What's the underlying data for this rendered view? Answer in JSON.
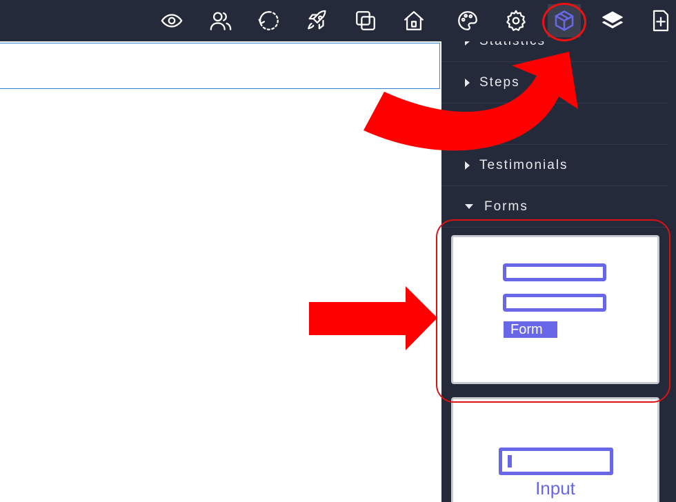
{
  "toolbar": {
    "icons": [
      {
        "name": "eye-icon",
        "active": false
      },
      {
        "name": "users-icon",
        "active": false
      },
      {
        "name": "history-icon",
        "active": false
      },
      {
        "name": "rocket-icon",
        "active": false
      },
      {
        "name": "duplicate-icon",
        "active": false
      },
      {
        "name": "home-icon",
        "active": false
      },
      {
        "name": "palette-icon",
        "active": false
      },
      {
        "name": "gear-icon",
        "active": false
      },
      {
        "name": "blocks-cube-icon",
        "active": true
      },
      {
        "name": "layers-icon",
        "active": false
      },
      {
        "name": "add-page-icon",
        "active": false
      }
    ],
    "active_color": "#6767e8"
  },
  "sidebar": {
    "categories": [
      {
        "label": "Statistics",
        "expanded": false
      },
      {
        "label": "Steps",
        "expanded": false
      },
      {
        "label": "",
        "expanded": false
      },
      {
        "label": "Testimonials",
        "expanded": false
      },
      {
        "label": "Forms",
        "expanded": true
      }
    ],
    "blocks": [
      {
        "label": "Form"
      },
      {
        "label": "Input"
      }
    ]
  },
  "colors": {
    "toolbar_bg": "#252a3a",
    "accent": "#6767e8",
    "annotation": "#ee1111"
  }
}
